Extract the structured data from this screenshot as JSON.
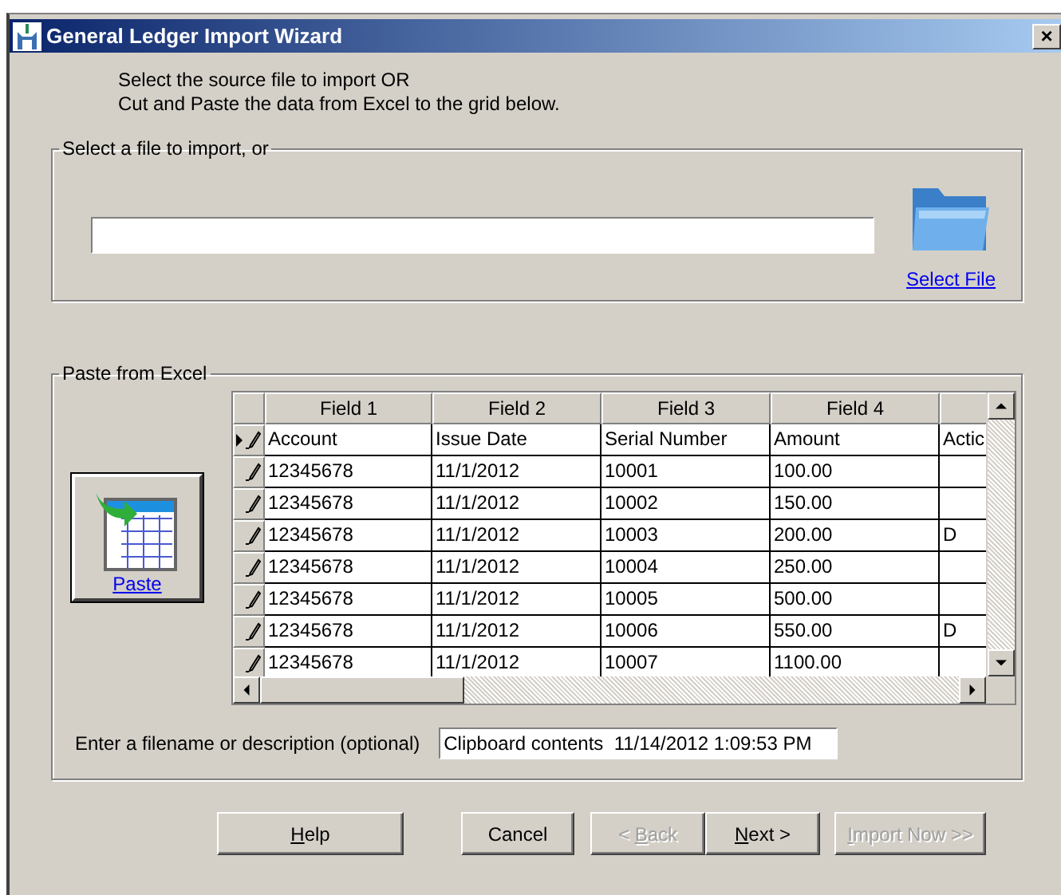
{
  "window": {
    "title": "General Ledger Import Wizard",
    "close": "×"
  },
  "instructions": [
    "Select the source file to import OR",
    "Cut and Paste the data from Excel to the grid below."
  ],
  "file_group": {
    "title": "Select a file to import, or",
    "select_link": "Select File"
  },
  "paste_group": {
    "title": "Paste from Excel",
    "paste_link": "Paste",
    "grid": {
      "columns": [
        "Field 1",
        "Field 2",
        "Field 3",
        "Field 4"
      ],
      "rows": [
        {
          "current": true,
          "field_1": "Account",
          "field_2": "Issue Date",
          "field_3": "Serial Number",
          "field_4": "Amount",
          "field_5": "Actic"
        },
        {
          "current": false,
          "field_1": "12345678",
          "field_2": "11/1/2012",
          "field_3": "10001",
          "field_4": "100.00"
        },
        {
          "current": false,
          "field_1": "12345678",
          "field_2": "11/1/2012",
          "field_3": "10002",
          "field_4": "150.00"
        },
        {
          "current": false,
          "field_1": "12345678",
          "field_2": "11/1/2012",
          "field_3": "10003",
          "field_4": "200.00",
          "field_5": "D"
        },
        {
          "current": false,
          "field_1": "12345678",
          "field_2": "11/1/2012",
          "field_3": "10004",
          "field_4": "250.00"
        },
        {
          "current": false,
          "field_1": "12345678",
          "field_2": "11/1/2012",
          "field_3": "10005",
          "field_4": "500.00"
        },
        {
          "current": false,
          "field_1": "12345678",
          "field_2": "11/1/2012",
          "field_3": "10006",
          "field_4": "550.00",
          "field_5": "D"
        },
        {
          "current": false,
          "field_1": "12345678",
          "field_2": "11/1/2012",
          "field_3": "10007",
          "field_4": "1100.00"
        }
      ]
    },
    "description_label": "Enter a filename or description (optional)",
    "description_value": "Clipboard contents  11/14/2012 1:09:53 PM"
  },
  "buttons": [
    {
      "accel": "H",
      "after": "elp",
      "disabled": false
    },
    {
      "before": "Cancel",
      "disabled": false
    },
    {
      "before": "< ",
      "accel": "B",
      "after": "ack",
      "disabled": true
    },
    {
      "accel": "N",
      "after": "ext >",
      "disabled": false
    },
    {
      "accel": "I",
      "after": "mport Now >>",
      "disabled": true
    }
  ]
}
